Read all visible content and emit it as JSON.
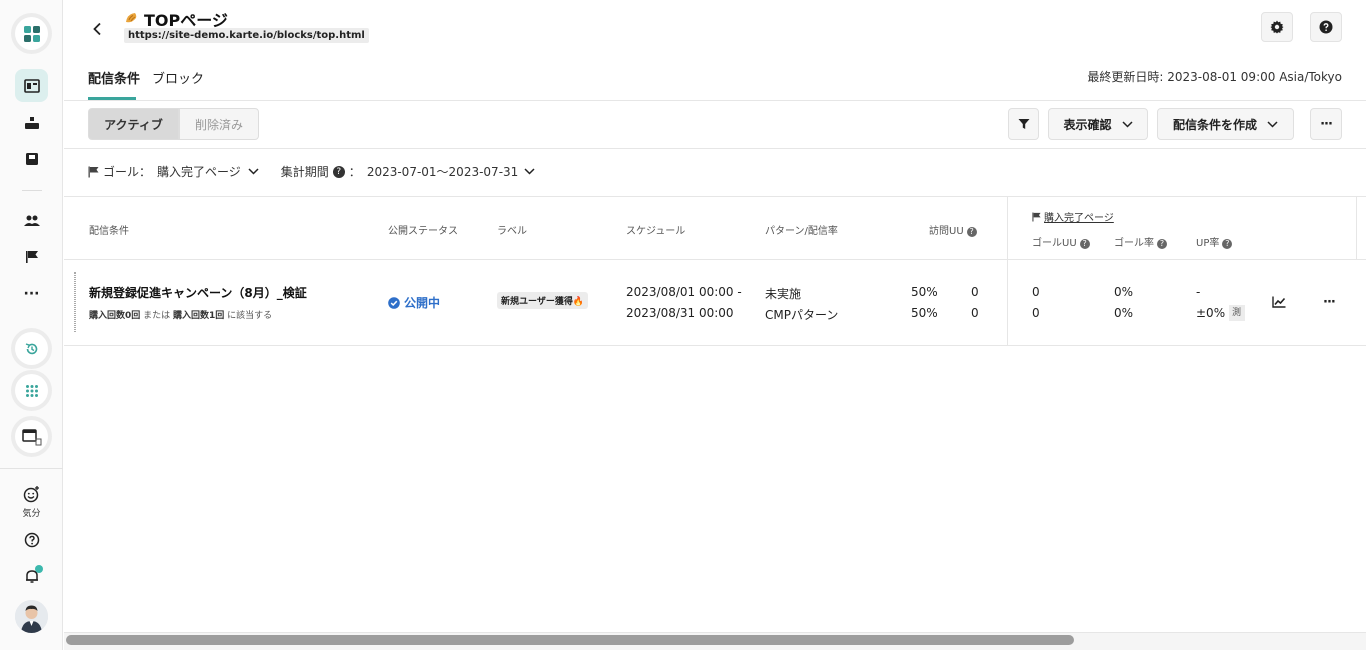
{
  "header": {
    "title": "TOPページ",
    "url": "https://site-demo.karte.io/blocks/top.html",
    "last_updated": "最終更新日時: 2023-08-01 09:00 Asia/Tokyo"
  },
  "sidebar": {
    "mood_label": "気分"
  },
  "tabs": [
    {
      "label": "配信条件",
      "active": true
    },
    {
      "label": "ブロック",
      "active": false
    }
  ],
  "toolbar": {
    "active_label": "アクティブ",
    "deleted_label": "削除済み",
    "preview_label": "表示確認",
    "create_label": "配信条件を作成"
  },
  "filters": {
    "goal_label": "ゴール：",
    "goal_value": "購入完了ページ",
    "period_label": "集計期間",
    "period_sep": "：",
    "period_value": "2023-07-01〜2023-07-31"
  },
  "table": {
    "headers": {
      "condition": "配信条件",
      "status": "公開ステータス",
      "label": "ラベル",
      "schedule": "スケジュール",
      "pattern": "パターン/配信率",
      "visit_uu": "訪問UU",
      "goal_link": "購入完了ページ",
      "goal_uu": "ゴールUU",
      "goal_rate": "ゴール率",
      "up_rate": "UP率"
    },
    "row": {
      "name": "新規登録促進キャンペーン（8月）_検証",
      "cond_a": "購入回数0回",
      "cond_or": "または",
      "cond_b": "購入回数1回",
      "cond_tail": "に該当する",
      "status": "公開中",
      "label": "新規ユーザー獲得🔥",
      "schedule_start": "2023/08/01 00:00 -",
      "schedule_end": "2023/08/31 00:00",
      "pattern_1": "未実施",
      "pattern_2": "CMPパターン",
      "rate_1": "50%",
      "rate_2": "50%",
      "visit_1": "0",
      "visit_2": "0",
      "goal_uu_1": "0",
      "goal_uu_2": "0",
      "goal_rate_1": "0%",
      "goal_rate_2": "0%",
      "up_1": "-",
      "up_2": "±0%",
      "measure_tag": "測定"
    }
  },
  "colors": {
    "accent": "#3aa59c",
    "status_blue": "#2e6fc9"
  }
}
